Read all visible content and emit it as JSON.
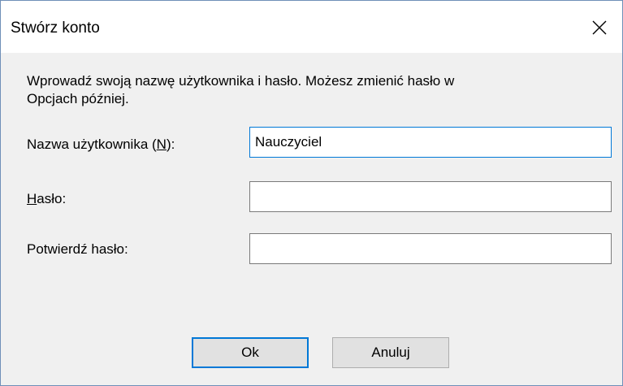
{
  "window": {
    "title": "Stwórz konto",
    "close_icon": "close-icon"
  },
  "prompt": {
    "text_line1": "Wprowadź swoją nazwę użytkownika i hasło. Możesz zmienić hasło w",
    "text_line2": "Opcjach później."
  },
  "fields": {
    "username": {
      "label_pre": "Nazwa użytkownika (",
      "label_accel": "N",
      "label_post": "):",
      "value": "Nauczyciel"
    },
    "password": {
      "label_accel": "H",
      "label_post": "asło:",
      "value": ""
    },
    "confirm": {
      "label": "Potwierdź hasło:",
      "value": ""
    }
  },
  "buttons": {
    "ok_label": "Ok",
    "cancel_label": "Anuluj"
  },
  "colors": {
    "accent": "#0078d7",
    "dialog_bg": "#f0f0f0",
    "titlebar_bg": "#ffffff"
  }
}
